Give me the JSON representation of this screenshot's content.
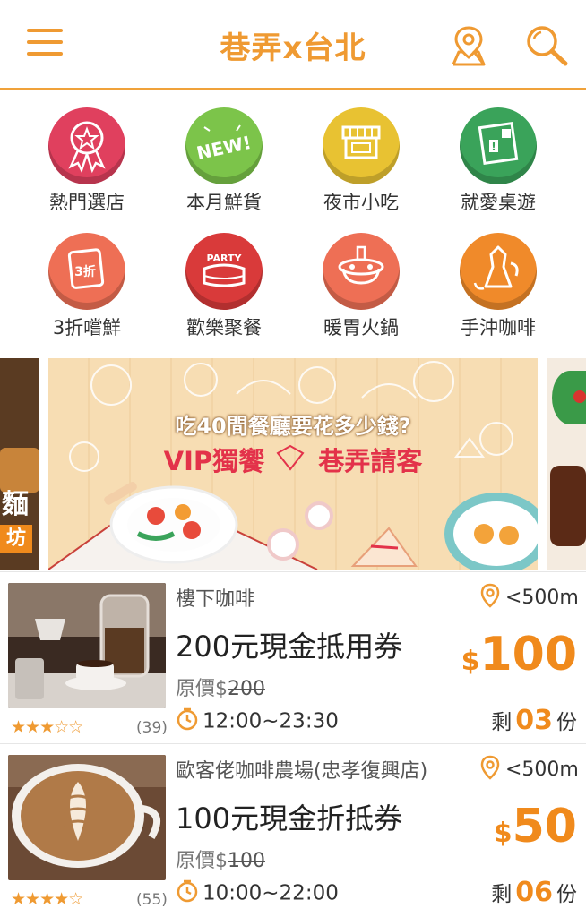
{
  "header": {
    "title": "巷弄x台北"
  },
  "categories": [
    {
      "label": "熱門選店",
      "color": "#e0405e",
      "icon": "ribbon-icon"
    },
    {
      "label": "本月鮮貨",
      "color": "#7cc44a",
      "icon": "new-icon",
      "icon_text": "NEW!"
    },
    {
      "label": "夜市小吃",
      "color": "#e8c232",
      "icon": "stall-icon"
    },
    {
      "label": "就愛桌遊",
      "color": "#3aa35a",
      "icon": "boardgame-icon"
    },
    {
      "label": "3折嚐鮮",
      "color": "#ee6f55",
      "icon": "discount-icon",
      "icon_text": "3折"
    },
    {
      "label": "歡樂聚餐",
      "color": "#d93a3a",
      "icon": "party-cake-icon",
      "icon_text": "PARTY"
    },
    {
      "label": "暖胃火鍋",
      "color": "#ee6f55",
      "icon": "hotpot-icon"
    },
    {
      "label": "手沖咖啡",
      "color": "#f08a2a",
      "icon": "coffee-pot-icon"
    }
  ],
  "banner": {
    "question": "吃40間餐廳要花多少錢?",
    "vip": "VIP獨饗",
    "invite": "巷弄請客",
    "left_text_1": "麵",
    "left_text_2": "坊"
  },
  "deals": [
    {
      "shop": "樓下咖啡",
      "distance": "<500m",
      "name": "200元現金抵用券",
      "orig_label": "原價$",
      "orig_price": "200",
      "hours": "12:00~23:30",
      "currency": "$",
      "price": "100",
      "remain_prefix": "剩",
      "remain": "03",
      "remain_suffix": "份",
      "rating": 3,
      "reviews": "(39)",
      "thumb": "coffee-pour-photo"
    },
    {
      "shop": "歐客佬咖啡農場(忠孝復興店)",
      "distance": "<500m",
      "name": "100元現金折抵券",
      "orig_label": "原價$",
      "orig_price": "100",
      "hours": "10:00~22:00",
      "currency": "$",
      "price": "50",
      "remain_prefix": "剩",
      "remain": "06",
      "remain_suffix": "份",
      "rating": 4,
      "reviews": "(55)",
      "thumb": "latte-art-photo"
    }
  ],
  "colors": {
    "accent": "#ef9a32",
    "price": "#f08a1c"
  }
}
